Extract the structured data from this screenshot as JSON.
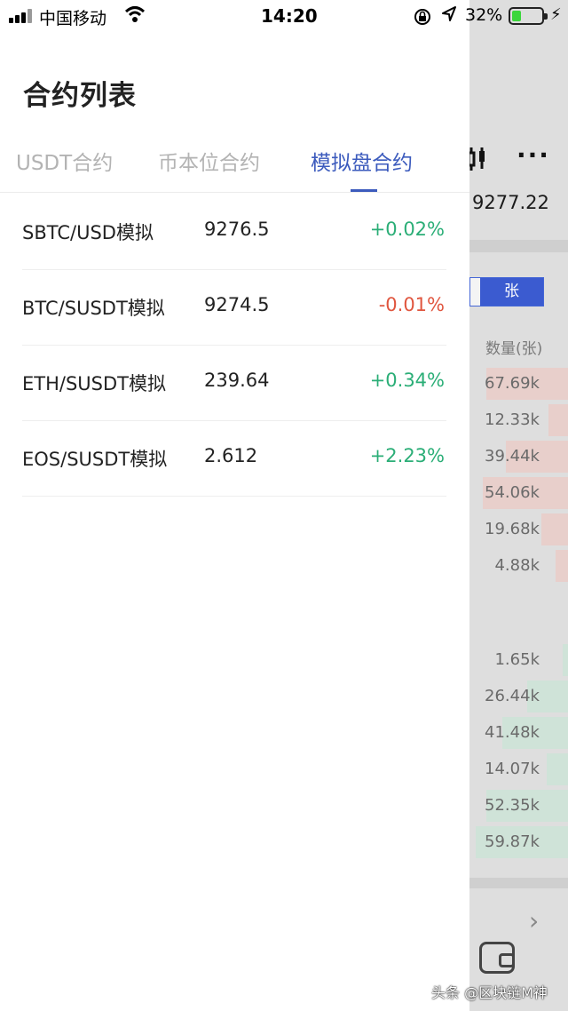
{
  "status_bar": {
    "carrier": "中国移动",
    "time": "14:20",
    "battery": "32%",
    "battery_level": 0.32,
    "icons": [
      "signal-icon",
      "wifi-icon",
      "orientation-lock-icon",
      "location-icon",
      "battery-icon",
      "charging-icon"
    ]
  },
  "drawer": {
    "title": "合约列表",
    "tabs": [
      {
        "label": "USDT合约",
        "active": false
      },
      {
        "label": "币本位合约",
        "active": false
      },
      {
        "label": "模拟盘合约",
        "active": true
      }
    ],
    "contracts": [
      {
        "name": "SBTC/USD模拟",
        "price": "9276.5",
        "change": "+0.02%",
        "direction": "up"
      },
      {
        "name": "BTC/SUSDT模拟",
        "price": "9274.5",
        "change": "-0.01%",
        "direction": "down"
      },
      {
        "name": "ETH/SUSDT模拟",
        "price": "239.64",
        "change": "+0.34%",
        "direction": "up"
      },
      {
        "name": "EOS/SUSDT模拟",
        "price": "2.612",
        "change": "+2.23%",
        "direction": "up"
      }
    ]
  },
  "background": {
    "last_price": "9277.22",
    "toggle_label": "张",
    "quantity_header": "数量(张)",
    "asks": [
      "67.69k",
      "12.33k",
      "39.44k",
      "54.06k",
      "19.68k",
      "4.88k"
    ],
    "bids": [
      "1.65k",
      "26.44k",
      "41.48k",
      "14.07k",
      "52.35k",
      "59.87k"
    ],
    "colors": {
      "ask_bar": "#e8cfcb",
      "bid_bar": "#cfe3d8"
    }
  },
  "watermark": "头条 @区块链M神",
  "colors": {
    "accent": "#3c5bbd",
    "up": "#2bae77",
    "down": "#e0563f"
  }
}
